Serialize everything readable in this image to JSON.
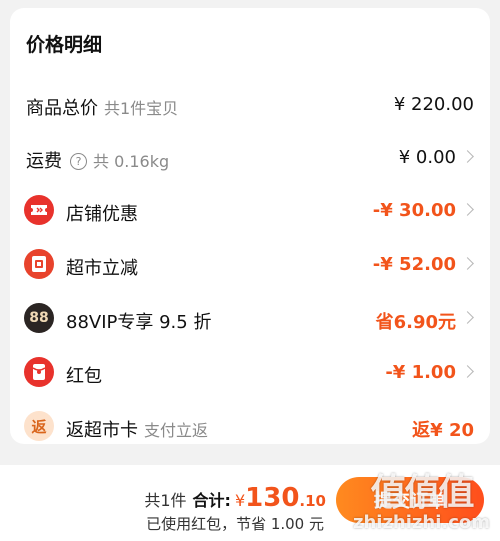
{
  "card": {
    "title": "价格明细",
    "rows": [
      {
        "label": "商品总价",
        "sub": "共1件宝贝",
        "value": "¥ 220.00"
      },
      {
        "label": "运费",
        "sub": "共 0.16kg",
        "value": "¥ 0.00"
      },
      {
        "label": "店铺优惠",
        "value": "-¥ 30.00",
        "icon": "coupon-ticket-icon"
      },
      {
        "label": "超市立减",
        "value": "-¥ 52.00",
        "icon": "supermarket-discount-icon"
      },
      {
        "label": "88VIP专享 9.5 折",
        "value": "省6.90元",
        "icon": "vip-88-icon",
        "icon_text": "88"
      },
      {
        "label": "红包",
        "value": "-¥ 1.00",
        "icon": "red-envelope-icon"
      },
      {
        "label": "返超市卡",
        "sub": "支付立返",
        "value": "返¥ 20",
        "icon": "rebate-icon",
        "icon_text": "返"
      }
    ],
    "help_icon": "?"
  },
  "bottom": {
    "count": "共1件",
    "total_label": "合计:",
    "currency": "¥",
    "total_int": "130",
    "total_dec": ".10",
    "savings": "已使用红包，节省 1.00 元",
    "submit": "提交订单"
  },
  "watermark": {
    "logo": "值值值",
    "url": "zhizhizhi.com"
  },
  "colors": {
    "accent": "#f2541b",
    "coupon_icon": "#e8322c",
    "discount_icon": "#e8432c",
    "vip_icon": "#2b2523",
    "redpacket_icon": "#e8322c",
    "rebate_icon": "#fde2cc"
  }
}
